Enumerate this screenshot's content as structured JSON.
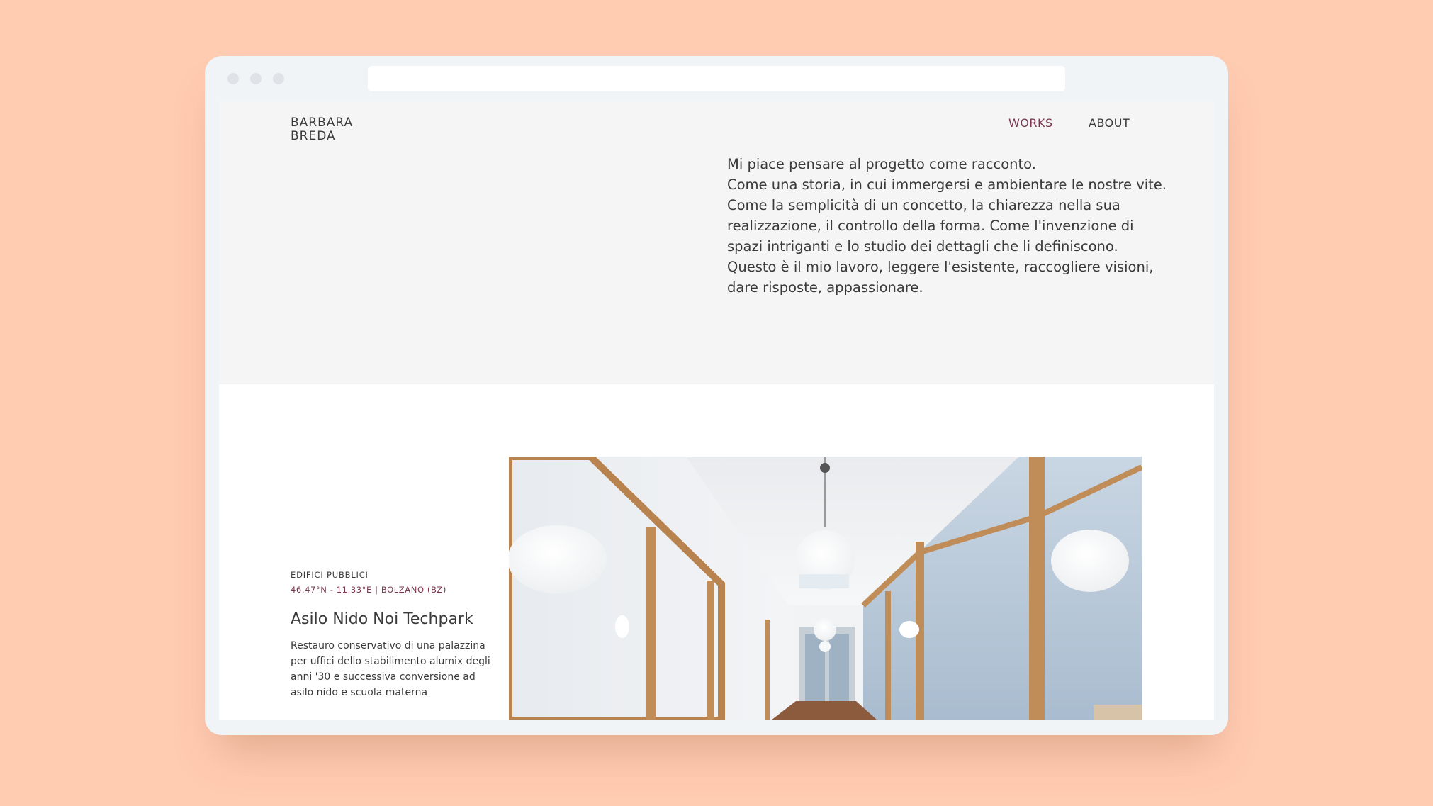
{
  "logo": {
    "line1": "BARBARA",
    "line2": "BREDA"
  },
  "nav": {
    "works": "WORKS",
    "about": "ABOUT"
  },
  "intro": {
    "lines": [
      "Mi piace pensare al progetto come racconto.",
      "Come una storia, in cui immergersi e ambientare le nostre vite.",
      "Come la semplicità di un concetto, la chiarezza nella sua",
      "realizzazione, il controllo della forma. Come l'invenzione di",
      "spazi intriganti e lo studio dei dettagli che li definiscono.",
      "Questo è il mio lavoro, leggere l'esistente, raccogliere visioni,",
      "dare risposte, appassionare."
    ]
  },
  "work": {
    "category": "EDIFICI PUBBLICI",
    "location": "46.47°N - 11.33°E | BOLZANO (BZ)",
    "title": "Asilo Nido Noi Techpark",
    "description": [
      "Restauro conservativo di una palazzina",
      "per uffici dello stabilimento alumix degli",
      "anni '30 e successiva conversione ad",
      "asilo nido e scuola materna"
    ]
  },
  "colors": {
    "background": "#ffcbb1",
    "accent": "#7a3550",
    "text": "#3a3a3a",
    "hero_bg": "#f5f5f5"
  }
}
